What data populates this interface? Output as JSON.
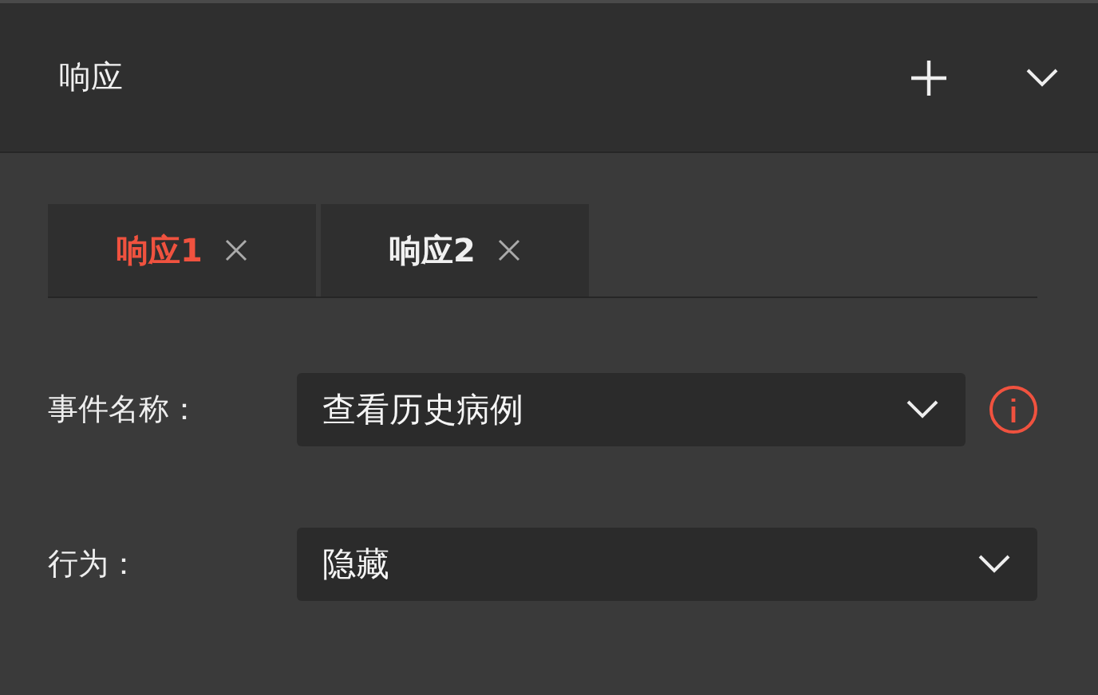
{
  "panel": {
    "title": "响应"
  },
  "tabs": [
    {
      "label": "响应1",
      "selected": true
    },
    {
      "label": "响应2",
      "selected": false
    }
  ],
  "fields": [
    {
      "label": "事件名称：",
      "value": "查看历史病例",
      "info": true
    },
    {
      "label": "行为：",
      "value": "隐藏",
      "info": false
    }
  ]
}
